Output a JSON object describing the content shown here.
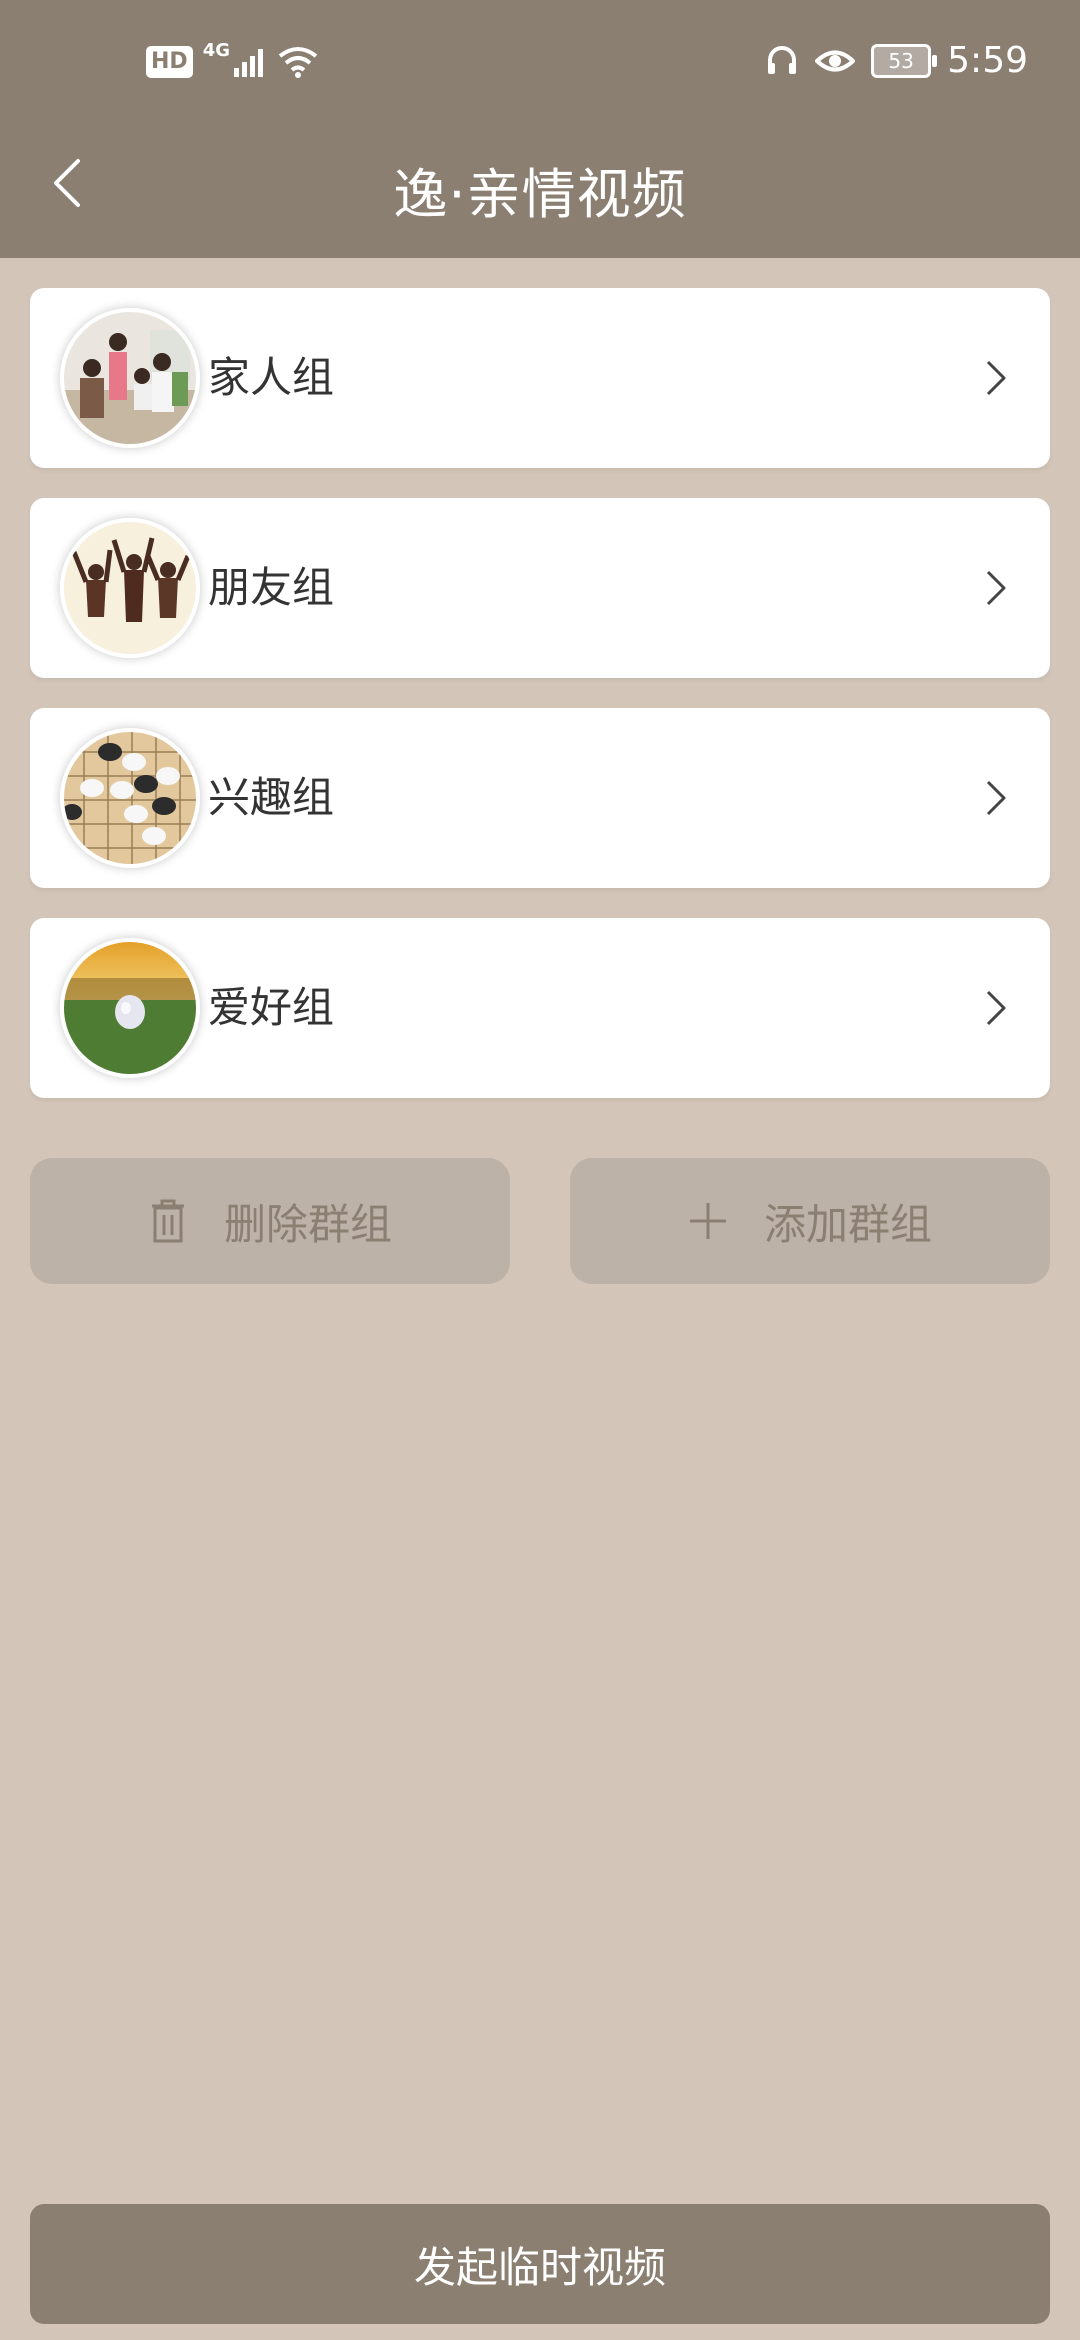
{
  "status_bar": {
    "hd_label": "HD",
    "network_label": "4G",
    "battery_level": "53",
    "time": "5:59"
  },
  "header": {
    "title": "逸·亲情视频"
  },
  "groups": [
    {
      "label": "家人组"
    },
    {
      "label": "朋友组"
    },
    {
      "label": "兴趣组"
    },
    {
      "label": "爱好组"
    }
  ],
  "actions": {
    "delete_label": "删除群组",
    "add_label": "添加群组"
  },
  "footer": {
    "start_video_label": "发起临时视频"
  },
  "colors": {
    "accent": "#8b7f72",
    "background": "#d3c6b9",
    "button_bg": "#bdb2a8"
  }
}
